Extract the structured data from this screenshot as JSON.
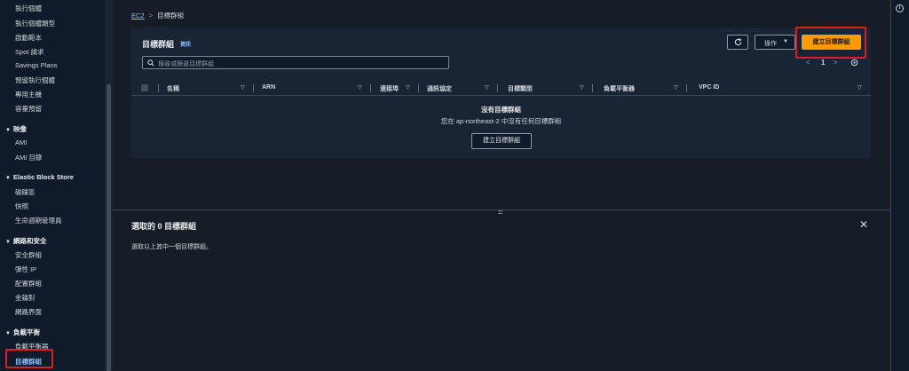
{
  "sidebar": {
    "items_top": [
      {
        "label": "執行個體"
      },
      {
        "label": "執行個體類型"
      },
      {
        "label": "啟動範本"
      },
      {
        "label": "Spot 請求"
      },
      {
        "label": "Savings Plans"
      },
      {
        "label": "預留執行個體"
      },
      {
        "label": "專用主機"
      },
      {
        "label": "容量預留"
      }
    ],
    "images": {
      "heading": "映像",
      "items": [
        {
          "label": "AMI"
        },
        {
          "label": "AMI 目錄"
        }
      ]
    },
    "ebs": {
      "heading": "Elastic Block Store",
      "items": [
        {
          "label": "磁碟區"
        },
        {
          "label": "快照"
        },
        {
          "label": "生命週期管理員"
        }
      ]
    },
    "network": {
      "heading": "網路和安全",
      "items": [
        {
          "label": "安全群組"
        },
        {
          "label": "彈性 IP"
        },
        {
          "label": "配置群組"
        },
        {
          "label": "金鑰對"
        },
        {
          "label": "網路界面"
        }
      ]
    },
    "lb": {
      "heading": "負載平衡",
      "items": [
        {
          "label": "負載平衡器"
        },
        {
          "label": "目標群組"
        }
      ]
    }
  },
  "breadcrumb": {
    "parent": "EC2",
    "current": "目標群組"
  },
  "panel": {
    "title": "目標群組",
    "info": "資訊",
    "search_placeholder": "搜尋或篩選目標群組",
    "actions_label": "操作",
    "create_label": "建立目標群組",
    "page": "1"
  },
  "table": {
    "columns": [
      "名稱",
      "ARN",
      "連接埠",
      "通訊協定",
      "目標類型",
      "負載平衡器",
      "VPC ID"
    ]
  },
  "empty": {
    "title": "沒有目標群組",
    "subtitle": "您在 ap-northeast-2 中沒有任何目標群組",
    "button": "建立目標群組"
  },
  "split_panel": {
    "handle": "=",
    "title": "選取的 0 目標群組",
    "message": "選取以上其中一個目標群組。"
  },
  "colors": {
    "accent": "#ff9900",
    "link": "#89bdff",
    "highlight": "#e01e1e"
  }
}
